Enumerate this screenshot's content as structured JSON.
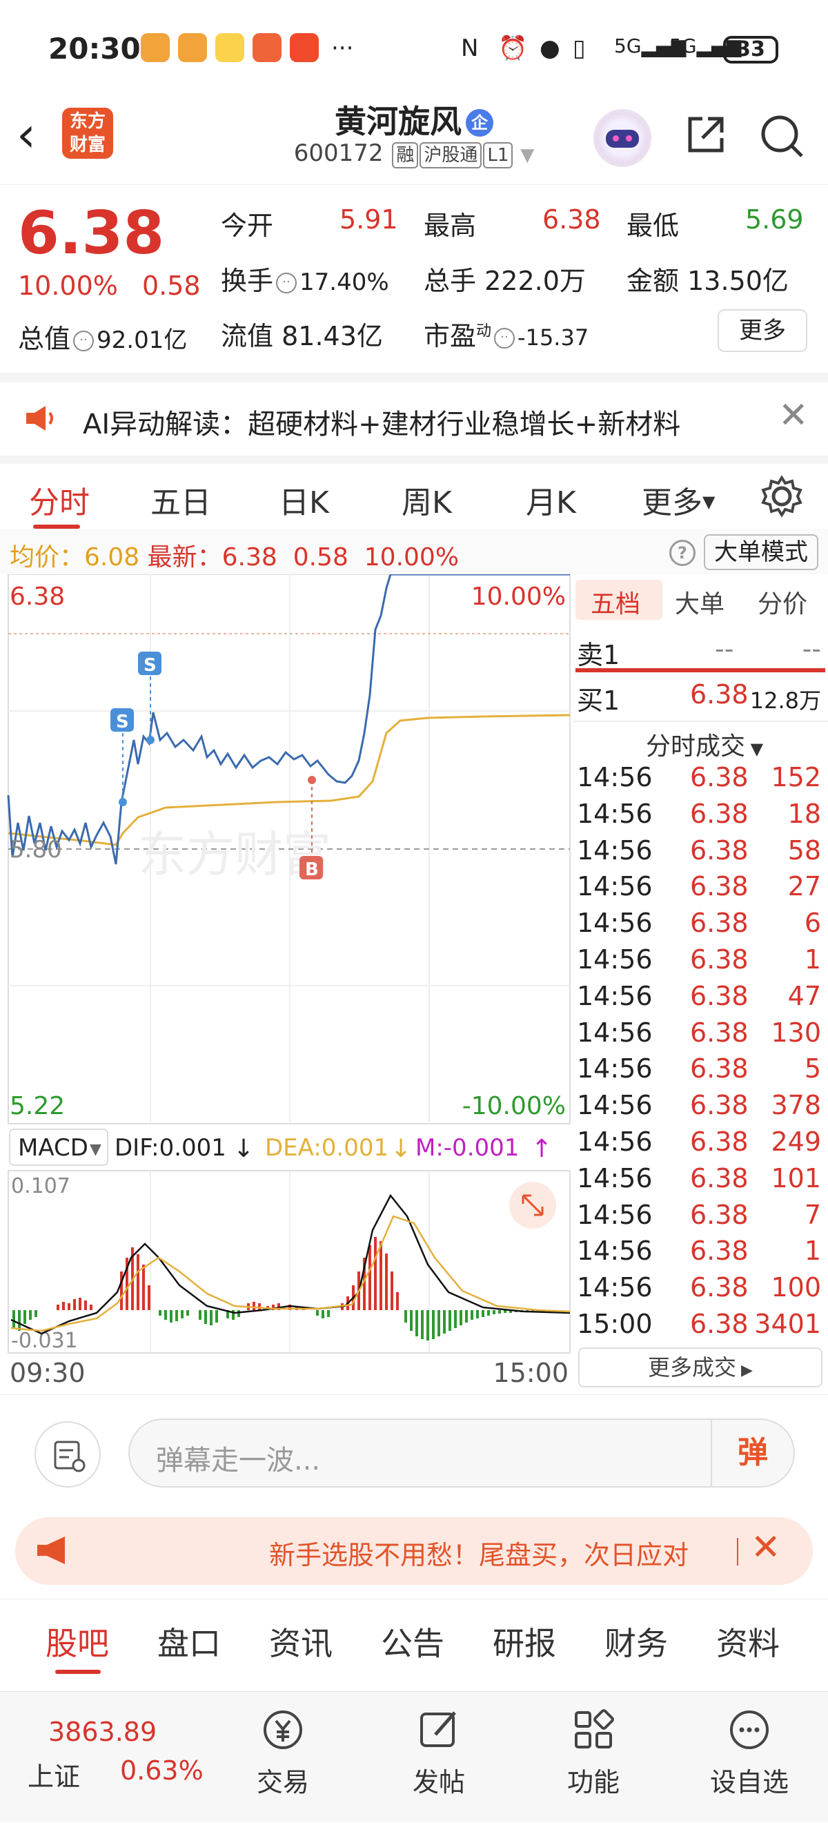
{
  "status_bar": {
    "time": "20:30",
    "battery": "33",
    "network": "5G",
    "more": "···"
  },
  "header": {
    "logo": "东方\n财富",
    "stock_name": "黄河旋风",
    "enterprise_badge": "企",
    "code": "600172",
    "tags": [
      "融",
      "沪股通",
      "L1"
    ]
  },
  "quote": {
    "price": "6.38",
    "change_pct": "10.00%",
    "change_amt": "0.58",
    "total_value_label": "总值",
    "total_value": "92.01亿",
    "items": [
      {
        "label": "今开",
        "value": "5.91"
      },
      {
        "label": "最高",
        "value": "6.38"
      },
      {
        "label": "最低",
        "value": "5.69"
      },
      {
        "label": "换手",
        "value": "17.40%"
      },
      {
        "label": "总手",
        "value": "222.0万"
      },
      {
        "label": "金额",
        "value": "13.50亿"
      },
      {
        "label": "流值",
        "value": "81.43亿"
      },
      {
        "label": "市盈",
        "value": "-15.37"
      }
    ],
    "pe_sup": "动",
    "more_button": "更多"
  },
  "ai_bar": {
    "text": "AI异动解读：超硬材料+建材行业稳增长+新材料"
  },
  "chart_tabs": [
    "分时",
    "五日",
    "日K",
    "周K",
    "月K",
    "更多"
  ],
  "info_line": {
    "avg_label": "均价：",
    "avg_value": "6.08",
    "latest_label": "最新：",
    "latest_value": "6.38",
    "change": "0.58",
    "change_pct": "10.00%",
    "mode_button": "大单模式",
    "help": "?"
  },
  "side_panel": {
    "tabs": [
      "五档",
      "大单",
      "分价"
    ],
    "sell1": {
      "label": "卖1",
      "price": "--",
      "vol": "--"
    },
    "buy1": {
      "label": "买1",
      "price": "6.38",
      "vol": "12.8万"
    },
    "ticks_header": "分时成交",
    "ticks": [
      {
        "time": "14:56",
        "price": "6.38",
        "vol": "152"
      },
      {
        "time": "14:56",
        "price": "6.38",
        "vol": "18"
      },
      {
        "time": "14:56",
        "price": "6.38",
        "vol": "58"
      },
      {
        "time": "14:56",
        "price": "6.38",
        "vol": "27"
      },
      {
        "time": "14:56",
        "price": "6.38",
        "vol": "6"
      },
      {
        "time": "14:56",
        "price": "6.38",
        "vol": "1"
      },
      {
        "time": "14:56",
        "price": "6.38",
        "vol": "47"
      },
      {
        "time": "14:56",
        "price": "6.38",
        "vol": "130"
      },
      {
        "time": "14:56",
        "price": "6.38",
        "vol": "5"
      },
      {
        "time": "14:56",
        "price": "6.38",
        "vol": "378"
      },
      {
        "time": "14:56",
        "price": "6.38",
        "vol": "249"
      },
      {
        "time": "14:56",
        "price": "6.38",
        "vol": "101"
      },
      {
        "time": "14:56",
        "price": "6.38",
        "vol": "7"
      },
      {
        "time": "14:56",
        "price": "6.38",
        "vol": "1"
      },
      {
        "time": "14:56",
        "price": "6.38",
        "vol": "100"
      },
      {
        "time": "15:00",
        "price": "6.38",
        "vol": "3401"
      }
    ],
    "more_ticks": "更多成交"
  },
  "chart_labels": {
    "top_price": "6.38",
    "top_pct": "10.00%",
    "mid_price": "5.80",
    "bottom_price": "5.22",
    "bottom_pct": "-10.00%",
    "watermark": "东方财富",
    "sell_marker": "S",
    "buy_marker": "B",
    "macd_select": "MACD",
    "dif": "DIF:0.001",
    "dea": "DEA:0.001",
    "m": "M:-0.001",
    "macd_top": "0.107",
    "macd_bottom": "-0.031",
    "time_start": "09:30",
    "time_end": "15:00"
  },
  "comment": {
    "placeholder": "弹幕走一波...",
    "danmu_button": "弹"
  },
  "promo": {
    "text": "新手选股不用愁！尾盘买，次日应对"
  },
  "sub_tabs": [
    "股吧",
    "盘口",
    "资讯",
    "公告",
    "研报",
    "财务",
    "资料"
  ],
  "bottom_nav": {
    "index_value": "3863.89",
    "index_name": "上证",
    "index_change": "0.63%",
    "items": [
      "交易",
      "发帖",
      "功能",
      "设自选"
    ]
  },
  "colors": {
    "up": "#d8342c",
    "down": "#2e9a2e",
    "price_line": "#3a6aae",
    "avg_line": "#e3b03a",
    "accent": "#e8542a"
  },
  "chart_data": {
    "type": "line",
    "title": "",
    "xlabel": "",
    "ylabel": "",
    "x_range": [
      "09:30",
      "15:00"
    ],
    "ylim": [
      5.22,
      6.38
    ],
    "prev_close": 5.8,
    "series": [
      {
        "name": "价格",
        "note_time_value_pairs": [
          [
            "09:30",
            5.94
          ],
          [
            "09:45",
            5.82
          ],
          [
            "10:00",
            5.86
          ],
          [
            "10:15",
            5.78
          ],
          [
            "10:20",
            5.98
          ],
          [
            "10:30",
            6.06
          ],
          [
            "10:45",
            6.04
          ],
          [
            "11:00",
            6.02
          ],
          [
            "11:15",
            5.98
          ],
          [
            "11:30",
            5.99
          ],
          [
            "13:00",
            5.99
          ],
          [
            "13:30",
            5.98
          ],
          [
            "14:00",
            5.96
          ],
          [
            "14:15",
            6.1
          ],
          [
            "14:25",
            6.38
          ],
          [
            "15:00",
            6.38
          ]
        ]
      },
      {
        "name": "均价",
        "note_time_value_pairs": [
          [
            "09:30",
            5.85
          ],
          [
            "10:15",
            5.83
          ],
          [
            "10:30",
            5.92
          ],
          [
            "11:30",
            5.95
          ],
          [
            "13:30",
            5.96
          ],
          [
            "14:15",
            5.98
          ],
          [
            "14:25",
            6.05
          ],
          [
            "15:00",
            6.08
          ]
        ]
      }
    ]
  }
}
